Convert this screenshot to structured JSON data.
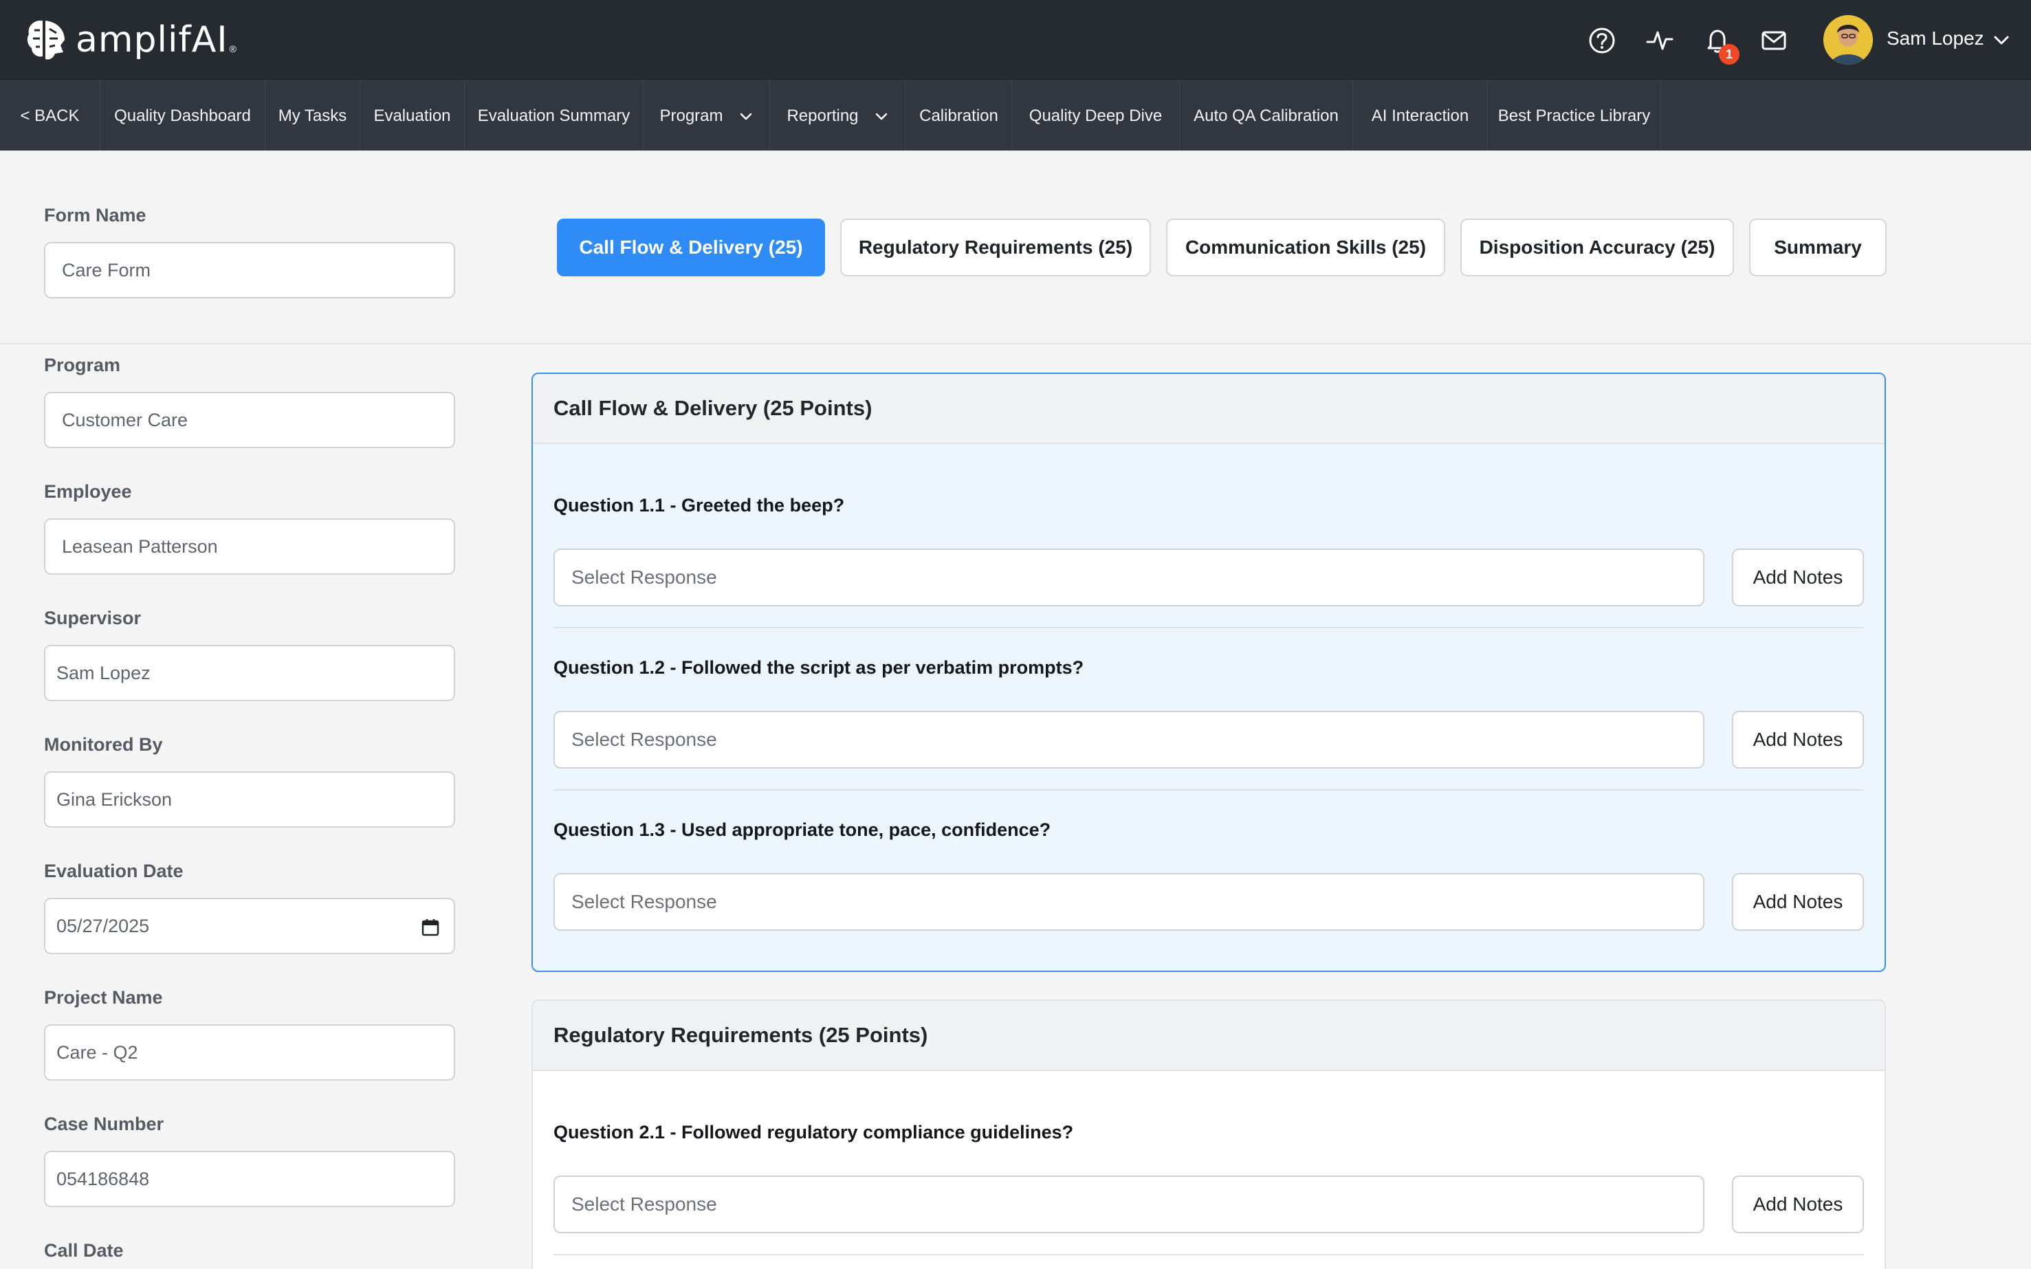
{
  "brand": {
    "name": "amplifAI",
    "reg": "®"
  },
  "user": {
    "name": "Sam Lopez",
    "notifications": "1"
  },
  "icons": {
    "help": "help-circle-icon",
    "activity": "activity-pulse-icon",
    "bell": "bell-icon",
    "mail": "mail-icon"
  },
  "colors": {
    "accent": "#2f8cf6",
    "topbar": "#262a31",
    "navbar": "#31363f",
    "badge": "#ef4a25"
  },
  "nav": {
    "back": "< BACK",
    "items": [
      "Quality Dashboard",
      "My Tasks",
      "Evaluation",
      "Evaluation Summary",
      "Program",
      "Reporting",
      "Calibration",
      "Quality Deep Dive",
      "Auto QA Calibration",
      "AI Interaction",
      "Best Practice Library"
    ]
  },
  "form": {
    "form_name_label": "Form Name",
    "form_name_value": "Care Form",
    "fields": [
      {
        "label": "Program",
        "value": "Customer Care"
      },
      {
        "label": "Employee",
        "value": "Leasean Patterson"
      },
      {
        "label": "Supervisor",
        "value": "Sam Lopez"
      },
      {
        "label": "Monitored By",
        "value": "Gina Erickson"
      },
      {
        "label": "Evaluation Date",
        "value": "05/27/2025"
      },
      {
        "label": "Project Name",
        "value": "Care - Q2"
      },
      {
        "label": "Case Number",
        "value": "054186848"
      },
      {
        "label": "Call Date",
        "value": ""
      }
    ]
  },
  "tabs": [
    {
      "label": "Call Flow & Delivery (25)",
      "active": true
    },
    {
      "label": "Regulatory Requirements (25)",
      "active": false
    },
    {
      "label": "Communication Skills (25)",
      "active": false
    },
    {
      "label": "Disposition Accuracy (25)",
      "active": false
    },
    {
      "label": "Summary",
      "active": false
    }
  ],
  "sections": [
    {
      "title": "Call Flow & Delivery (25 Points)",
      "questions": [
        {
          "text": "Question 1.1 - Greeted the beep?",
          "placeholder": "Select Response",
          "notes": "Add Notes"
        },
        {
          "text": "Question 1.2 - Followed the script as per verbatim prompts?",
          "placeholder": "Select Response",
          "notes": "Add Notes"
        },
        {
          "text": "Question 1.3 - Used appropriate tone, pace, confidence?",
          "placeholder": "Select Response",
          "notes": "Add Notes"
        }
      ]
    },
    {
      "title": "Regulatory Requirements (25 Points)",
      "questions": [
        {
          "text": "Question 2.1 - Followed regulatory compliance guidelines?",
          "placeholder": "Select Response",
          "notes": "Add Notes"
        }
      ]
    }
  ]
}
